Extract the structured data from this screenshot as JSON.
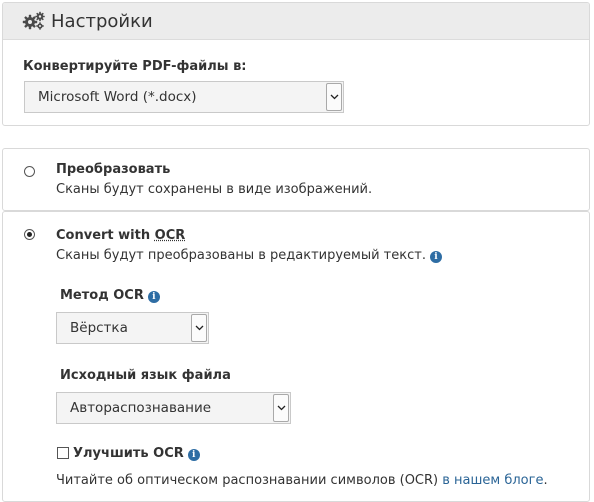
{
  "settings": {
    "title": "Настройки",
    "convert_label": "Конвертируйте PDF-файлы в:",
    "format_select": {
      "value": "Microsoft Word (*.docx)"
    }
  },
  "options": [
    {
      "title": "Преобразовать",
      "description": "Сканы будут сохранены в виде изображений.",
      "selected": false
    },
    {
      "title_prefix": "Convert with ",
      "title_ocr": "OCR",
      "description": "Сканы будут преобразованы в редактируемый текст.",
      "selected": true
    }
  ],
  "ocr": {
    "method_label": "Метод OCR",
    "method_value": "Вёрстка",
    "language_label": "Исходный язык файла",
    "language_value": "Автораспознавание",
    "improve_label": "Улучшить OCR",
    "improve_checked": false,
    "read_more_text": "Читайте об оптическом распознавании символов (OCR) ",
    "read_more_link": "в нашем блоге",
    "read_more_end": "."
  },
  "colors": {
    "info_icon": "#2e6da4",
    "link": "#2a6496",
    "heading_bg": "#ececec"
  },
  "icons": {
    "heading": "gears-icon",
    "info": "info-icon",
    "select_arrow": "chevron-down-icon"
  }
}
